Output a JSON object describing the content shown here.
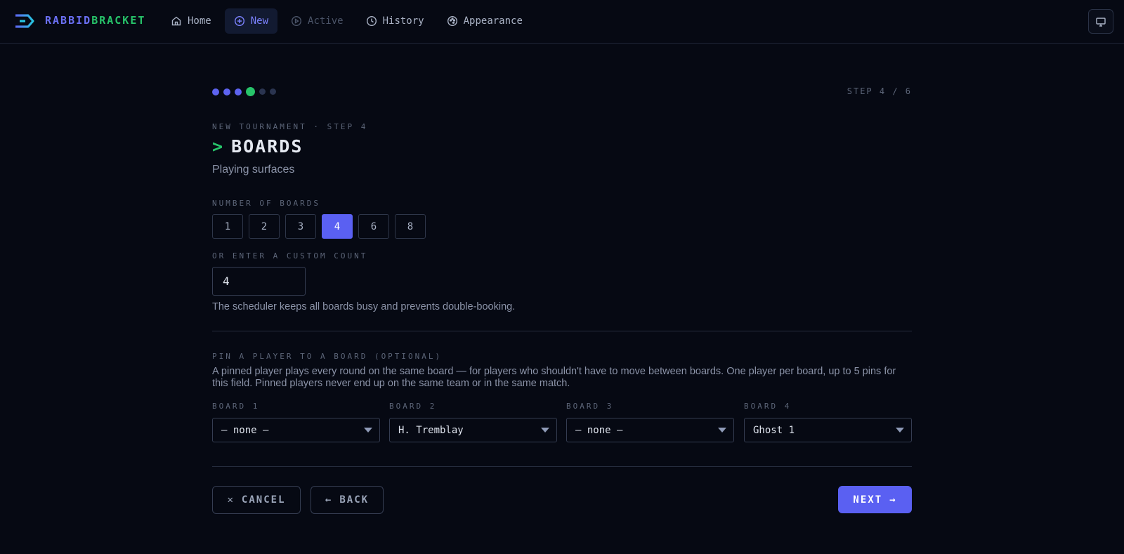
{
  "app": {
    "brand_part1": "RABBID",
    "brand_part2": "BRACKET",
    "colors": {
      "accent": "#5a60f2",
      "brand_blue": "#6b70f5",
      "brand_green": "#27c46a",
      "background": "#060913"
    }
  },
  "nav": {
    "items": [
      {
        "label": "Home",
        "icon": "home-icon"
      },
      {
        "label": "New",
        "icon": "plus-circle-icon",
        "active": true
      },
      {
        "label": "Active",
        "icon": "play-circle-icon",
        "disabled": true
      },
      {
        "label": "History",
        "icon": "clock-icon"
      },
      {
        "label": "Appearance",
        "icon": "palette-icon"
      }
    ],
    "display_button_icon": "monitor-icon"
  },
  "wizard": {
    "total_steps": 6,
    "current_step": 4,
    "step_label": "STEP 4 / 6",
    "eyebrow": "NEW TOURNAMENT · STEP 4",
    "prompt": ">",
    "title": "BOARDS",
    "subtitle": "Playing surfaces"
  },
  "boards": {
    "count_label": "NUMBER OF BOARDS",
    "options": [
      "1",
      "2",
      "3",
      "4",
      "6",
      "8"
    ],
    "selected": "4",
    "custom_label": "OR ENTER A CUSTOM COUNT",
    "custom_value": "4",
    "helper": "The scheduler keeps all boards busy and prevents double-booking."
  },
  "pins": {
    "label": "PIN A PLAYER TO A BOARD (OPTIONAL)",
    "description": "A pinned player plays every round on the same board — for players who shouldn't have to move between boards. One player per board, up to 5 pins for this field. Pinned players never end up on the same team or in the same match.",
    "boards": [
      {
        "label": "BOARD 1",
        "value": "— none —"
      },
      {
        "label": "BOARD 2",
        "value": "H. Tremblay"
      },
      {
        "label": "BOARD 3",
        "value": "— none —"
      },
      {
        "label": "BOARD 4",
        "value": "Ghost 1"
      }
    ]
  },
  "actions": {
    "cancel": "CANCEL",
    "cancel_icon": "✕",
    "back": "BACK",
    "back_icon": "←",
    "next": "NEXT",
    "next_icon": "→"
  }
}
